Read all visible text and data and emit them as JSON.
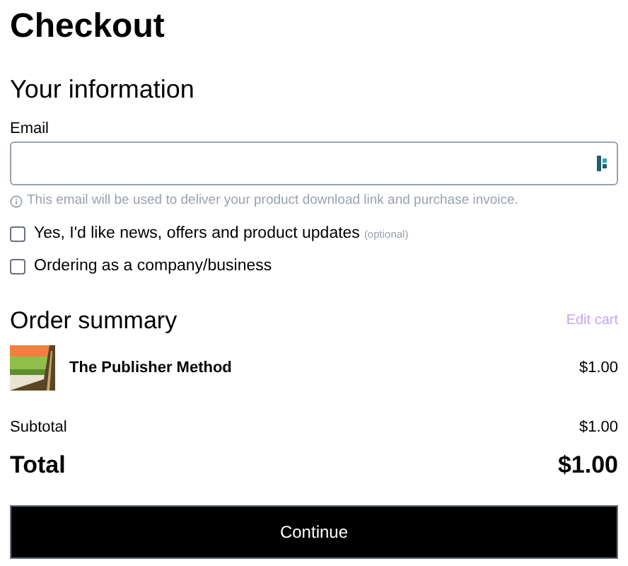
{
  "title": "Checkout",
  "your_information": {
    "heading": "Your information",
    "email": {
      "label": "Email",
      "hint": "This email will be used to deliver your product download link and purchase invoice."
    },
    "options": [
      {
        "label": "Yes, I'd like news, offers and product updates",
        "note": "(optional)",
        "checked": false
      },
      {
        "label": "Ordering as a company/business",
        "checked": false
      }
    ]
  },
  "order_summary": {
    "heading": "Order summary",
    "edit_link": "Edit cart",
    "items": [
      {
        "kind": "picture",
        "name": "The Publisher Method",
        "price": "$1.00"
      }
    ],
    "subtotal": {
      "label": "Subtotal",
      "value": "$1.00"
    },
    "total": {
      "label": "Total",
      "value": "$1.00"
    }
  },
  "continue_button": "Continue"
}
